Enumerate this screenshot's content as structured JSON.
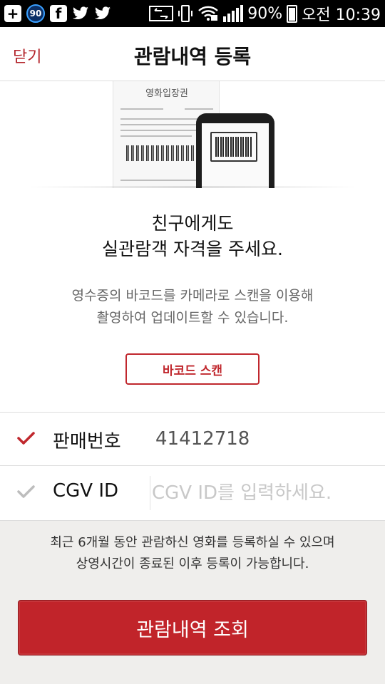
{
  "status_bar": {
    "left_icons": [
      "add-icon",
      "badge-90-icon",
      "facebook-icon",
      "twitter-icon",
      "twitter-icon"
    ],
    "badge_number": "90",
    "battery_percent": "90%",
    "time": "오전 10:39"
  },
  "header": {
    "close_label": "닫기",
    "title": "관람내역 등록"
  },
  "main": {
    "headline_line1": "친구에게도",
    "headline_line2": "실관람객 자격을 주세요.",
    "desc_line1": "영수증의 바코드를 카메라로 스캔을 이용해",
    "desc_line2": "촬영하여 업데이트할 수 있습니다.",
    "scan_button": "바코드 스캔",
    "ticket_title": "영화입장권"
  },
  "form": {
    "sale_number_label": "판매번호",
    "sale_number_value": "41412718",
    "cgv_id_label": "CGV ID",
    "cgv_id_placeholder": "CGV ID를 입력하세요.",
    "cgv_id_value": ""
  },
  "footer": {
    "notice_line1": "최근 6개월 동안 관람하신 영화를 등록하실 수 있으며",
    "notice_line2": "상영시간이 종료된 이후 등록이 가능합니다.",
    "history_button": "관람내역 조회"
  },
  "colors": {
    "accent": "#c1242a",
    "check_active": "#c0272d",
    "check_inactive": "#bdbdbd",
    "footer_bg": "#efeeec"
  }
}
